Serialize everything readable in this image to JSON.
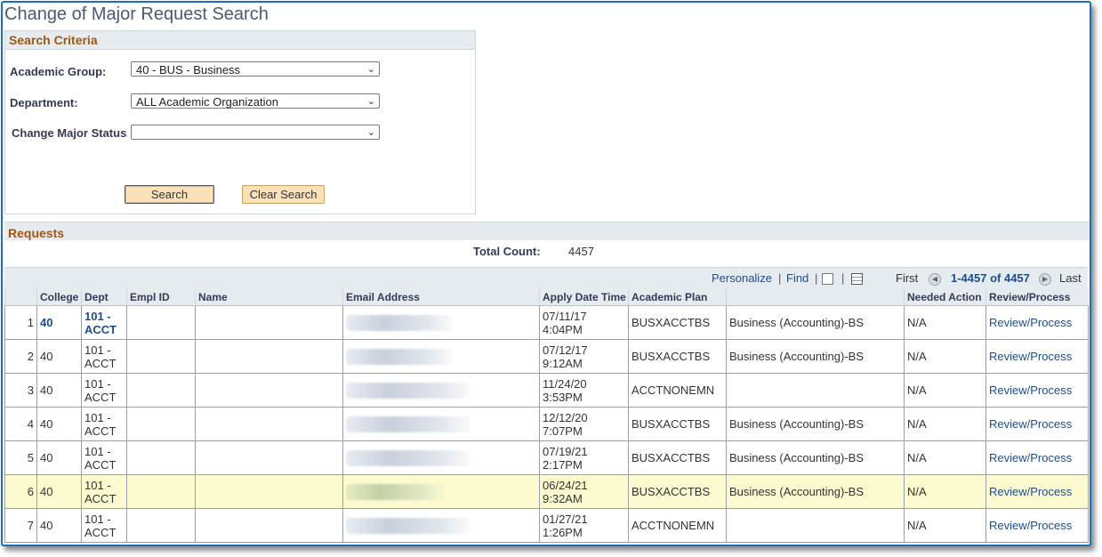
{
  "page": {
    "title": "Change of Major Request Search"
  },
  "search_criteria": {
    "heading": "Search Criteria",
    "fields": [
      {
        "label": "Academic Group:",
        "value": "40 - BUS - Business"
      },
      {
        "label": "Department:",
        "value": "ALL Academic Organization"
      },
      {
        "label": "Change Major Status",
        "value": ""
      }
    ],
    "search_label": "Search",
    "clear_label": "Clear Search"
  },
  "requests": {
    "heading": "Requests",
    "total_label": "Total Count:",
    "total_value": "4457",
    "toolbar": {
      "personalize": "Personalize",
      "find": "Find",
      "first": "First",
      "range": "1-4457 of 4457",
      "last": "Last"
    },
    "columns": [
      "",
      "College",
      "Dept",
      "Empl ID",
      "Name",
      "Email Address",
      "Apply Date Time",
      "Academic Plan",
      "",
      "Needed Action",
      "Review/Process"
    ],
    "rows": [
      {
        "n": "1",
        "college": "40",
        "dept": "101 - ACCT",
        "date": "07/11/17",
        "time": "4:04PM",
        "plan": "BUSXACCTBS",
        "plan_desc": "Business (Accounting)-BS",
        "action": "N/A",
        "review": "Review/Process"
      },
      {
        "n": "2",
        "college": "40",
        "dept": "101 - ACCT",
        "date": "07/12/17",
        "time": "9:12AM",
        "plan": "BUSXACCTBS",
        "plan_desc": "Business (Accounting)-BS",
        "action": "N/A",
        "review": "Review/Process"
      },
      {
        "n": "3",
        "college": "40",
        "dept": "101 - ACCT",
        "date": "11/24/20",
        "time": "3:53PM",
        "plan": "ACCTNONEMN",
        "plan_desc": "",
        "action": "N/A",
        "review": "Review/Process"
      },
      {
        "n": "4",
        "college": "40",
        "dept": "101 - ACCT",
        "date": "12/12/20",
        "time": "7:07PM",
        "plan": "BUSXACCTBS",
        "plan_desc": "Business (Accounting)-BS",
        "action": "N/A",
        "review": "Review/Process"
      },
      {
        "n": "5",
        "college": "40",
        "dept": "101 - ACCT",
        "date": "07/19/21",
        "time": "2:17PM",
        "plan": "BUSXACCTBS",
        "plan_desc": "Business (Accounting)-BS",
        "action": "N/A",
        "review": "Review/Process"
      },
      {
        "n": "6",
        "college": "40",
        "dept": "101 - ACCT",
        "date": "06/24/21",
        "time": "9:32AM",
        "plan": "BUSXACCTBS",
        "plan_desc": "Business (Accounting)-BS",
        "action": "N/A",
        "review": "Review/Process"
      },
      {
        "n": "7",
        "college": "40",
        "dept": "101 - ACCT",
        "date": "01/27/21",
        "time": "1:26PM",
        "plan": "ACCTNONEMN",
        "plan_desc": "",
        "action": "N/A",
        "review": "Review/Process"
      }
    ]
  },
  "colors": {
    "frame_border": "#1a6fb8",
    "section_heading": "#a35612",
    "link": "#1f4c8f",
    "highlight_row": "#fbfbcf",
    "button_fill": "#fbe1b8"
  }
}
